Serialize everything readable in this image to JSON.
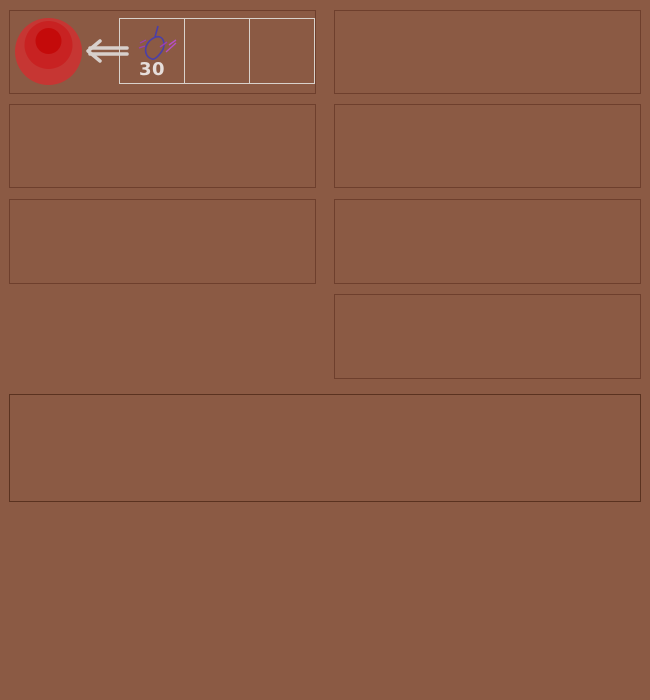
{
  "board": {
    "background": "#8b5a44",
    "panel_border": "#6e3f2d"
  },
  "player_orb": {
    "icon": "red-orb-icon",
    "color": "#d42424"
  },
  "direction_arrow": {
    "icon": "arrow-left-icon"
  },
  "inventory": {
    "slots": [
      {
        "icon": "leaf-spell-icon",
        "count": "30"
      },
      {
        "icon": "",
        "count": ""
      },
      {
        "icon": "",
        "count": ""
      }
    ]
  }
}
